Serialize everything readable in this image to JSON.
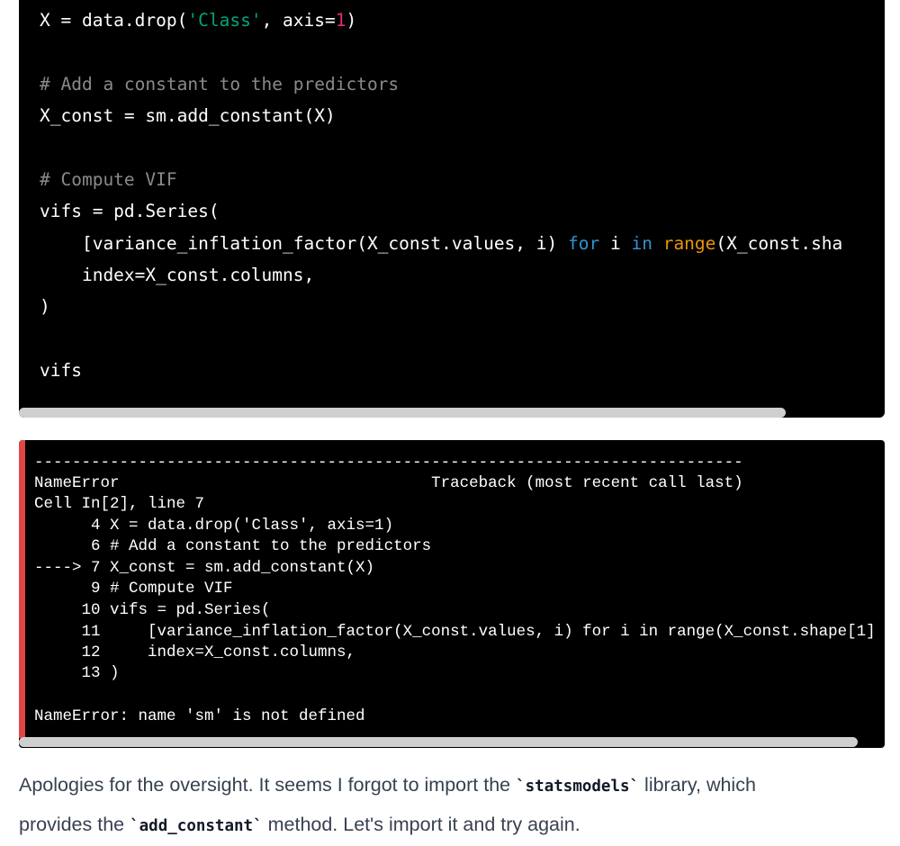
{
  "code_block": {
    "lines": [
      [
        {
          "t": "X = data.drop(",
          "c": "plain"
        },
        {
          "t": "'Class'",
          "c": "string"
        },
        {
          "t": ", axis=",
          "c": "plain"
        },
        {
          "t": "1",
          "c": "number"
        },
        {
          "t": ")",
          "c": "plain"
        }
      ],
      [
        {
          "t": "# Add a constant to the predictors",
          "c": "comment"
        }
      ],
      [
        {
          "t": "X_const = sm.add_constant(X)",
          "c": "plain"
        }
      ],
      [
        {
          "t": "# Compute VIF",
          "c": "comment"
        }
      ],
      [
        {
          "t": "vifs = pd.Series(",
          "c": "plain"
        }
      ],
      [
        {
          "t": "    [variance_inflation_factor(X_const.values, i) ",
          "c": "plain"
        },
        {
          "t": "for",
          "c": "keyword"
        },
        {
          "t": " i ",
          "c": "plain"
        },
        {
          "t": "in",
          "c": "keyword"
        },
        {
          "t": " ",
          "c": "plain"
        },
        {
          "t": "range",
          "c": "builtin"
        },
        {
          "t": "(X_const.sha",
          "c": "plain"
        }
      ],
      [
        {
          "t": "    index=X_const.columns,",
          "c": "plain"
        }
      ],
      [
        {
          "t": ")",
          "c": "plain"
        }
      ],
      [
        {
          "t": "vifs",
          "c": "plain"
        }
      ]
    ]
  },
  "error_output": {
    "lines": [
      "---------------------------------------------------------------------------",
      "NameError                                 Traceback (most recent call last)",
      "Cell In[2], line 7",
      "      4 X = data.drop('Class', axis=1)",
      "      6 # Add a constant to the predictors",
      "----> 7 X_const = sm.add_constant(X)",
      "      9 # Compute VIF",
      "     10 vifs = pd.Series(",
      "     11     [variance_inflation_factor(X_const.values, i) for i in range(X_const.shape[1]",
      "     12     index=X_const.columns,",
      "     13 )",
      "",
      "NameError: name 'sm' is not defined"
    ]
  },
  "message": {
    "line1_before": "Apologies for the oversight. It seems I forgot to import the ",
    "line1_code": "`statsmodels`",
    "line1_after": " library, which",
    "line2_before": "provides the ",
    "line2_code": "`add_constant`",
    "line2_after": " method. Let's import it and try again."
  }
}
